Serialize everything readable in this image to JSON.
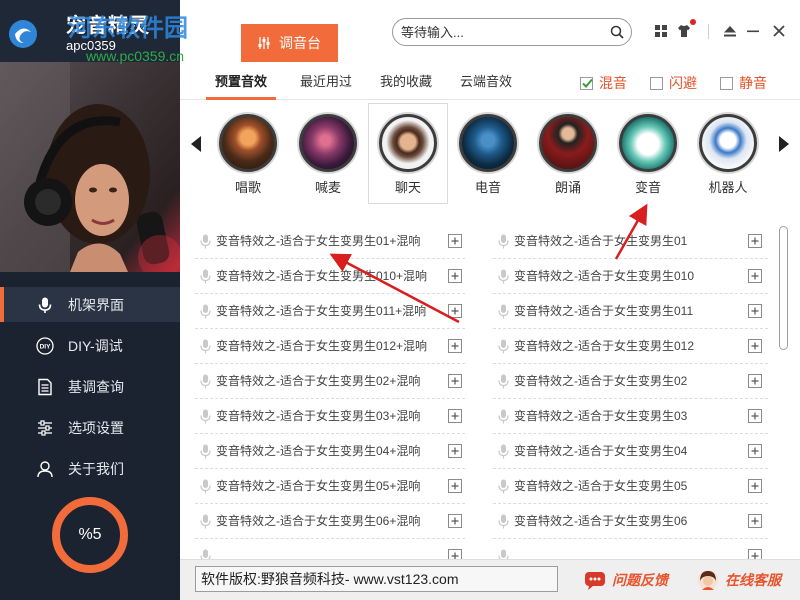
{
  "app": {
    "title": "宠音精灵",
    "watermark": {
      "name": "河东软件园",
      "sub": "apc0359",
      "url": "www.pc0359.cn"
    }
  },
  "colors": {
    "accent": "#f26b3a",
    "sidebar_bg": "#1b2331",
    "option_text": "#e8542c",
    "annotation_arrow": "#d81e1e"
  },
  "sidebar": {
    "items": [
      {
        "label": "机架界面",
        "icon": "microphone-icon",
        "active": true
      },
      {
        "label": "DIY-调试",
        "icon": "diy-icon",
        "icon_text": "DIY",
        "active": false
      },
      {
        "label": "基调查询",
        "icon": "document-icon",
        "active": false
      },
      {
        "label": "选项设置",
        "icon": "sliders-icon",
        "active": false
      },
      {
        "label": "关于我们",
        "icon": "user-icon",
        "active": false
      }
    ],
    "meter": {
      "text": "%5"
    }
  },
  "header": {
    "tab": {
      "label": "调音台",
      "icon": "sliders-icon"
    },
    "search": {
      "placeholder": "等待输入...",
      "value": "",
      "icon": "search-icon"
    },
    "controls": [
      {
        "icon": "grid-icon"
      },
      {
        "icon": "skin-icon",
        "badge": true
      },
      {
        "icon": "eject-icon"
      },
      {
        "icon": "minimize-icon"
      },
      {
        "icon": "close-icon"
      }
    ]
  },
  "subtabs": [
    {
      "label": "预置音效",
      "active": true
    },
    {
      "label": "最近用过",
      "active": false
    },
    {
      "label": "我的收藏",
      "active": false
    },
    {
      "label": "云端音效",
      "active": false
    }
  ],
  "options": [
    {
      "label": "混音",
      "checked": true
    },
    {
      "label": "闪避",
      "checked": false
    },
    {
      "label": "静音",
      "checked": false
    }
  ],
  "presets": {
    "prev_icon": "chevron-left-icon",
    "next_icon": "chevron-right-icon",
    "items": [
      {
        "label": "唱歌",
        "selected": false
      },
      {
        "label": "喊麦",
        "selected": false
      },
      {
        "label": "聊天",
        "selected": true
      },
      {
        "label": "电音",
        "selected": false
      },
      {
        "label": "朗诵",
        "selected": false
      },
      {
        "label": "变音",
        "selected": false
      },
      {
        "label": "机器人",
        "selected": false
      }
    ]
  },
  "effects": {
    "left": [
      {
        "label": "变音特效之-适合于女生变男生01+混响"
      },
      {
        "label": "变音特效之-适合于女生变男生010+混响"
      },
      {
        "label": "变音特效之-适合于女生变男生011+混响"
      },
      {
        "label": "变音特效之-适合于女生变男生012+混响"
      },
      {
        "label": "变音特效之-适合于女生变男生02+混响"
      },
      {
        "label": "变音特效之-适合于女生变男生03+混响"
      },
      {
        "label": "变音特效之-适合于女生变男生04+混响"
      },
      {
        "label": "变音特效之-适合于女生变男生05+混响"
      },
      {
        "label": "变音特效之-适合于女生变男生06+混响"
      }
    ],
    "right": [
      {
        "label": "变音特效之-适合于女生变男生01"
      },
      {
        "label": "变音特效之-适合于女生变男生010"
      },
      {
        "label": "变音特效之-适合于女生变男生011"
      },
      {
        "label": "变音特效之-适合于女生变男生012"
      },
      {
        "label": "变音特效之-适合于女生变男生02"
      },
      {
        "label": "变音特效之-适合于女生变男生03"
      },
      {
        "label": "变音特效之-适合于女生变男生04"
      },
      {
        "label": "变音特效之-适合于女生变男生05"
      },
      {
        "label": "变音特效之-适合于女生变男生06"
      }
    ]
  },
  "footer": {
    "copyright": "软件版权:野狼音频科技- www.vst123.com",
    "feedback": "问题反馈",
    "service": "在线客服"
  }
}
